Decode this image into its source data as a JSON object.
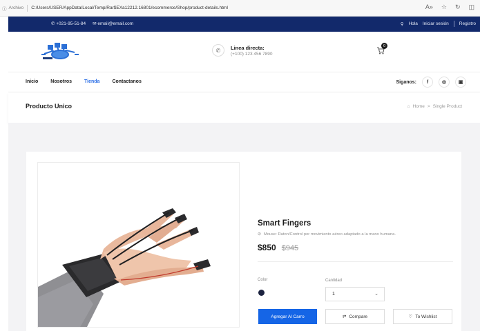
{
  "browser": {
    "site_info": "Archivo",
    "url": "C:/Users/USER/AppData/Local/Temp/Rar$EXa12212.16801/ecommerce/Shop/product-details.html"
  },
  "topbar": {
    "phone": "+021-95-51-84",
    "email": "email@email.com",
    "greeting": "Hola",
    "login": "Iniciar sesión",
    "register": "Registro"
  },
  "header": {
    "hotline_title": "Linea directa:",
    "hotline_number": "(+100) 123 456 7890",
    "cart_count": "0"
  },
  "nav": {
    "items": [
      {
        "label": "Inicio"
      },
      {
        "label": "Nosotros"
      },
      {
        "label": "Tienda"
      },
      {
        "label": "Contactanos"
      }
    ],
    "active": "Tienda",
    "follow_label": "Siganos:",
    "social_icons": [
      "facebook-icon",
      "instagram-icon",
      "twitter-icon"
    ]
  },
  "breadcrumb": {
    "page_title": "Producto Unico",
    "home": "Home",
    "separator": ">",
    "current": "Single Product"
  },
  "product": {
    "name": "Smart Fingers",
    "description": "Mouse: Raton/Control por movimiento aéreo adaptado a la mano humana.",
    "price": "$850",
    "old_price": "$945",
    "color_label": "Color",
    "quantity_label": "Cantidad",
    "quantity_value": "1",
    "add_to_cart": "Agregar Al Carro",
    "compare": "Compare",
    "wishlist": "To Wishlist"
  },
  "colors": {
    "topbar_bg": "#12296b",
    "accent": "#2c6fe6",
    "primary_button": "#1565e6",
    "swatch": "#1c2340"
  }
}
